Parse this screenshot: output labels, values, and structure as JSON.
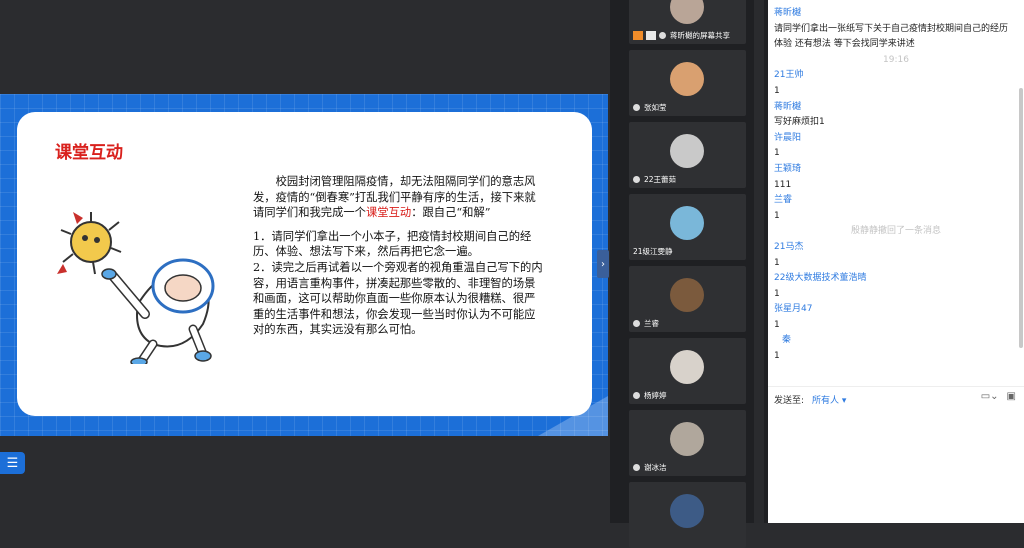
{
  "slide": {
    "title": "课堂互动",
    "intro_pre": "校园封闭管理阻隔疫情，却无法阻隔同学们的意志风发，疫情的“倒春寒”打乱我们平静有序的生活，接下来就请同学们和我完成一个",
    "intro_highlight": "课堂互动",
    "intro_post": "：跟自己“和解”",
    "step1": "1．请同学们拿出一个小本子，把疫情封校期间自己的经历、体验、想法写下来，然后再把它念一遍。",
    "step2": "2．读完之后再试着以一个旁观者的视角重温自己写下的内容，用语言重构事件，拼凑起那些零散的、非理智的场景和画面，这可以帮助你直面一些你原本认为很糟糕、很严重的生活事件和想法，你会发现一些当时你认为不可能应对的东西，其实远没有那么可怕。"
  },
  "videos": [
    {
      "name": "蒋昕樾的屏幕共享",
      "color": "#b9a597"
    },
    {
      "name": "张如莹",
      "color": "#d9a070"
    },
    {
      "name": "22王蕾茹",
      "color": "#c9c9c9"
    },
    {
      "name": "21级江雯静",
      "color": "#7ab7d9"
    },
    {
      "name": "兰睿",
      "color": "#7b5a3d"
    },
    {
      "name": "杨婷婷",
      "color": "#d8d2cb"
    },
    {
      "name": "谢冰洁",
      "color": "#b0a79c"
    },
    {
      "name": "",
      "color": "#3d5b86"
    }
  ],
  "chat": {
    "messages": [
      {
        "type": "user",
        "name": "蒋昕樾",
        "text": "请同学们拿出一张纸写下关于自己疫情封校期间自己的经历 体验 还有想法 等下会找同学来讲述"
      },
      {
        "type": "time",
        "text": "19:16"
      },
      {
        "type": "user",
        "name": "21王帅",
        "text": "1"
      },
      {
        "type": "user",
        "name": "蒋昕樾",
        "text": "写好麻烦扣1"
      },
      {
        "type": "user",
        "name": "许晨阳",
        "text": "1"
      },
      {
        "type": "user",
        "name": "王颖琦",
        "text": "111"
      },
      {
        "type": "user",
        "name": "兰睿",
        "text": "1"
      },
      {
        "type": "system",
        "text": "殷静静撤回了一条消息"
      },
      {
        "type": "user",
        "name": "21马杰",
        "text": "1"
      },
      {
        "type": "user",
        "name": "22级大数据技术董浩晴",
        "text": "1"
      },
      {
        "type": "user",
        "name": "张星月47",
        "text": "1"
      },
      {
        "type": "user",
        "name": "秦",
        "text": "1"
      }
    ],
    "send_to_label": "发送至:",
    "send_to_target": "所有人 ▾"
  }
}
